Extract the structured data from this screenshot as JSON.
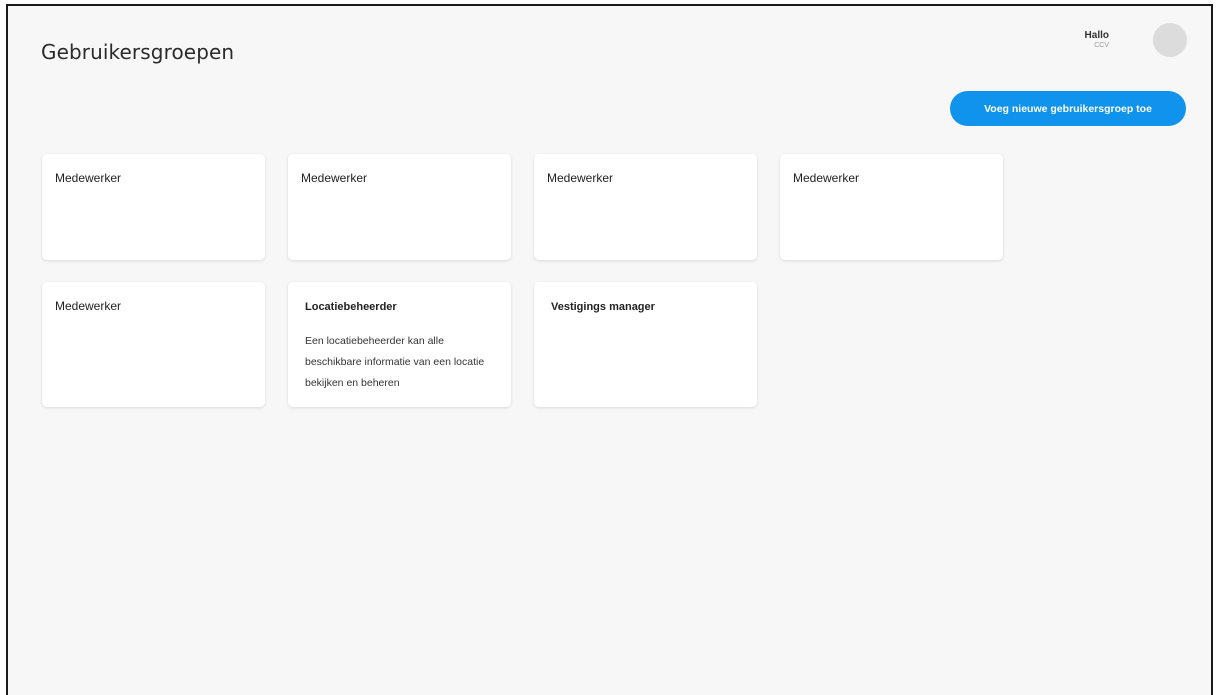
{
  "page": {
    "title": "Gebruikersgroepen"
  },
  "user": {
    "greeting": "Hallo",
    "name": "CCV"
  },
  "actions": {
    "add_group_label": "Voeg nieuwe gebruikersgroep toe"
  },
  "colors": {
    "accent": "#0f93ec",
    "background": "#f7f7f7",
    "card": "#ffffff",
    "avatar": "#dcdcdc"
  },
  "groups": [
    {
      "name": "Medewerker"
    },
    {
      "name": "Medewerker"
    },
    {
      "name": "Medewerker"
    },
    {
      "name": "Medewerker"
    },
    {
      "name": "Medewerker"
    },
    {
      "name": "Locatiebeheerder",
      "description": "Een locatiebeheerder kan alle beschikbare informatie van een locatie bekijken en beheren"
    },
    {
      "name": "Vestigings manager"
    }
  ]
}
